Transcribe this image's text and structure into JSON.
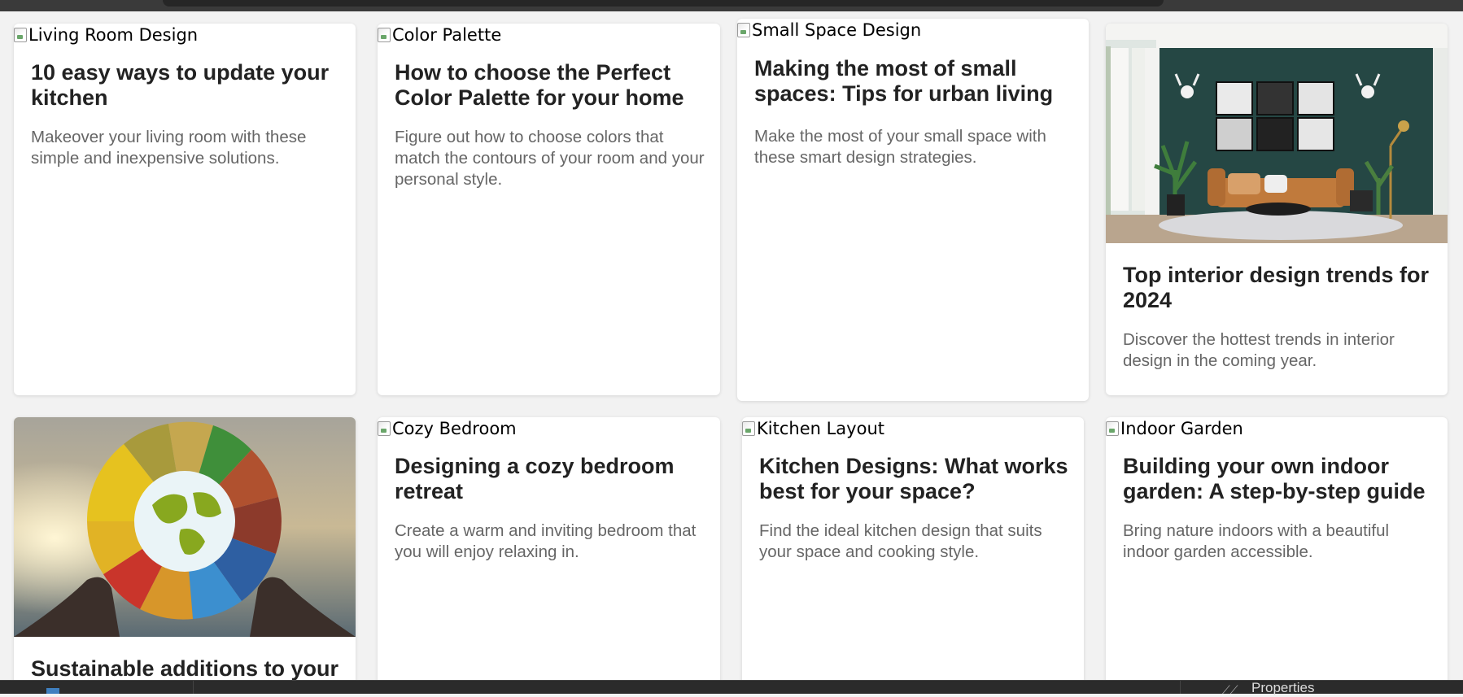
{
  "cards": [
    {
      "image_alt": "Living Room Design",
      "title": "10 easy ways to update your kitchen",
      "description": "Makeover your living room with these simple and inexpensive solutions."
    },
    {
      "image_alt": "Color Palette",
      "title": "How to choose the Perfect Color Palette for your home",
      "description": "Figure out how to choose colors that match the contours of your room and your personal style."
    },
    {
      "image_alt": "Small Space Design",
      "title": "Making the most of small spaces: Tips for urban living",
      "description": "Make the most of your small space with these smart design strategies."
    },
    {
      "title": "Top interior design trends for 2024",
      "description": "Discover the hottest trends in interior design in the coming year."
    },
    {
      "title": "Sustainable additions to your",
      "description": ""
    },
    {
      "image_alt": "Cozy Bedroom",
      "title": "Designing a cozy bedroom retreat",
      "description": "Create a warm and inviting bedroom that you will enjoy relaxing in."
    },
    {
      "image_alt": "Kitchen Layout",
      "title": "Kitchen Designs: What works best for your space?",
      "description": "Find the ideal kitchen design that suits your space and cooking style."
    },
    {
      "image_alt": "Indoor Garden",
      "title": "Building your own indoor garden: A step-by-step guide",
      "description": "Bring nature indoors with a beautiful indoor garden accessible."
    }
  ],
  "bottom_panel": {
    "properties_label": "Properties"
  }
}
